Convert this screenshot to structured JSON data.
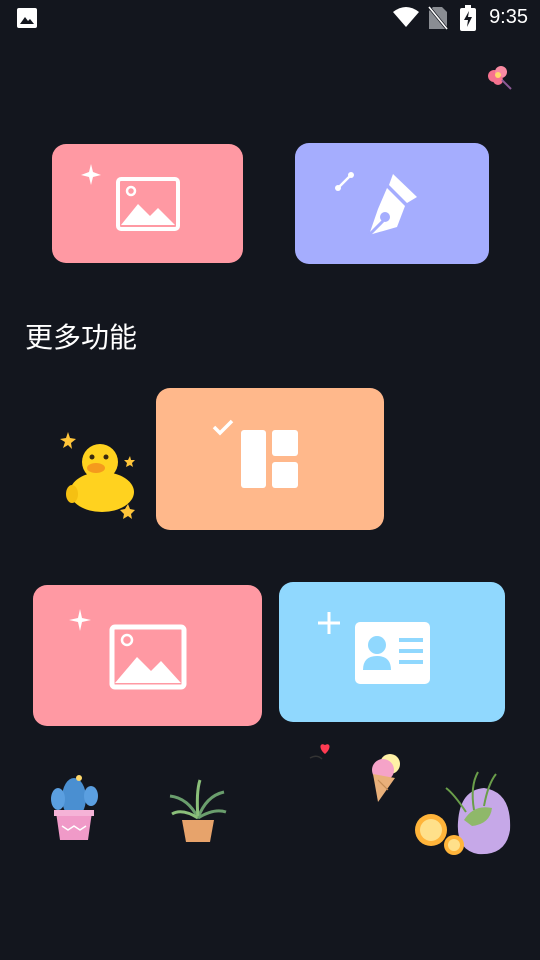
{
  "status_bar": {
    "time": "9:35",
    "icons": [
      "gallery-notification-icon",
      "wifi-icon",
      "no-sim-icon",
      "battery-charging-icon"
    ]
  },
  "header": {
    "decor_icon": "flower-sticker-icon"
  },
  "top_actions": [
    {
      "icon": "photo-edit-icon",
      "color": "#ff99a3"
    },
    {
      "icon": "pen-draw-icon",
      "color": "#a5adfe"
    }
  ],
  "more": {
    "title": "更多功能",
    "cards": [
      {
        "icon": "collage-layout-icon",
        "color": "#ffb88b"
      },
      {
        "icon": "photo-add-icon",
        "color": "#ff99a3"
      },
      {
        "icon": "id-photo-icon",
        "color": "#90d8fe"
      }
    ]
  },
  "stickers": [
    "duck-sticker",
    "cactus-sticker",
    "plant-sticker",
    "heart-sticker",
    "ice-cream-sticker",
    "succulent-lemon-sticker"
  ]
}
